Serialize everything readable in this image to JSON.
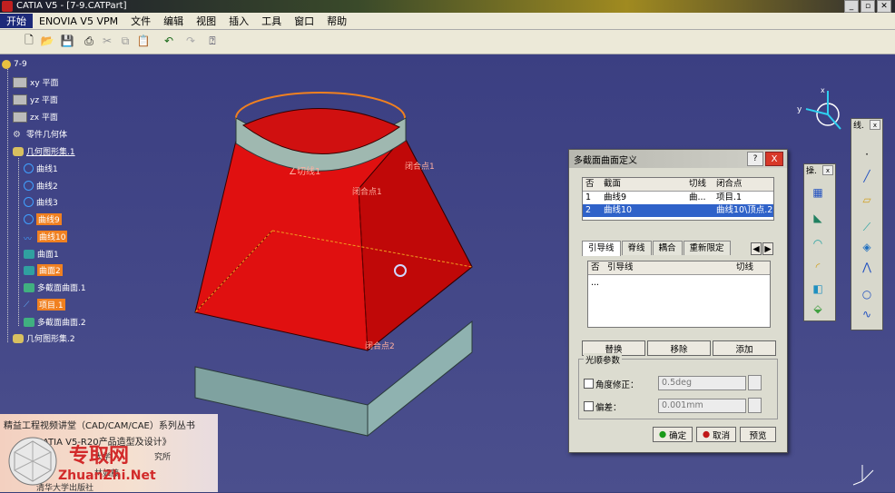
{
  "window": {
    "title": "CATIA V5 - [7-9.CATPart]"
  },
  "menu": [
    "开始",
    "ENOVIA V5 VPM",
    "文件",
    "编辑",
    "视图",
    "插入",
    "工具",
    "窗口",
    "帮助"
  ],
  "tree": {
    "root": "7-9",
    "items": [
      {
        "label": "xy 平面"
      },
      {
        "label": "yz 平面"
      },
      {
        "label": "zx 平面"
      },
      {
        "label": "零件几何体"
      },
      {
        "label": "几何图形集.1"
      },
      {
        "label": "曲线1"
      },
      {
        "label": "曲线2"
      },
      {
        "label": "曲线3"
      },
      {
        "label": "曲线9"
      },
      {
        "label": "曲线10"
      },
      {
        "label": "曲面1"
      },
      {
        "label": "曲面2"
      },
      {
        "label": "多截面曲面.1"
      },
      {
        "label": "项目.1"
      },
      {
        "label": "多截面曲面.2"
      },
      {
        "label": "几何图形集.2"
      }
    ]
  },
  "model_labels": {
    "tangent": "∠切线1",
    "closing_top": "闭合点1",
    "closing_top2": "闭合点1",
    "closing_bottom": "闭合点2"
  },
  "dialog": {
    "title": "多截面曲面定义",
    "help": "?",
    "close": "X",
    "sections_headers": [
      "否",
      "截面",
      "切线",
      "闭合点"
    ],
    "sections": [
      {
        "no": "1",
        "name": "曲线9",
        "tangent": "曲...",
        "closing": "项目.1"
      },
      {
        "no": "2",
        "name": "曲线10",
        "tangent": "",
        "closing": "曲线10\\顶点.2"
      }
    ],
    "tabs": [
      "引导线",
      "脊线",
      "耦合",
      "重新限定"
    ],
    "guide_headers": [
      "否",
      "引导线",
      "切线"
    ],
    "guide_placeholder": "...",
    "buttons": {
      "replace": "替换",
      "remove": "移除",
      "add": "添加"
    },
    "smooth_group": "光顺参数",
    "angle_label": "角度修正：",
    "angle_value": "0.5deg",
    "deviation_label": "偏差：",
    "deviation_value": "0.001mm",
    "ok": "确定",
    "cancel": "取消",
    "preview": "预览"
  },
  "panels": {
    "wireframe": "线.",
    "operations": "操."
  },
  "banner": {
    "series": "精益工程视频讲堂（CAD/CAM/CAE）系列丛书",
    "book": "CATIA V5-R20产品造型及设计》",
    "line2": "大学",
    "line2b": "究所",
    "line3": "林如藤",
    "publisher": "清华大学出版社",
    "watermark_cn": "专取网",
    "watermark_en": "ZhuanZhi.Net"
  },
  "colors": {
    "accent_orange": "#f08020",
    "surface_red": "#e01010",
    "select_blue": "#2f62c9"
  }
}
